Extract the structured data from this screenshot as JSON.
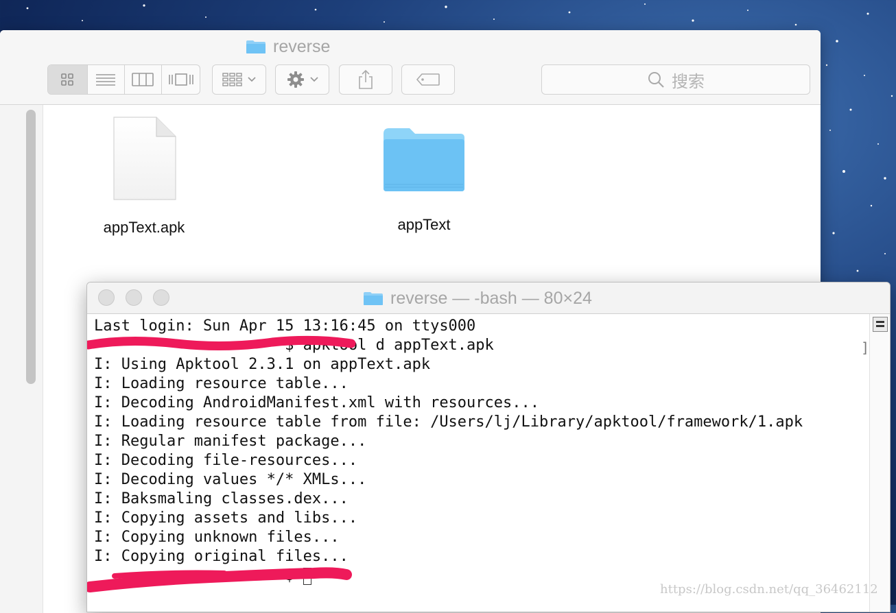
{
  "desktop": {
    "background": "#1d3f7a"
  },
  "finder": {
    "title": "reverse",
    "search_placeholder": "搜索",
    "files": [
      {
        "name": "appText.apk",
        "icon": "document-icon"
      },
      {
        "name": "appText",
        "icon": "folder-icon"
      }
    ]
  },
  "terminal": {
    "title": "reverse — -bash — 80×24",
    "lines": [
      "Last login: Sun Apr 15 13:16:45 on ttys000",
      "                     $ apktool d appText.apk",
      "I: Using Apktool 2.3.1 on appText.apk",
      "I: Loading resource table...",
      "I: Decoding AndroidManifest.xml with resources...",
      "I: Loading resource table from file: /Users/lj/Library/apktool/framework/1.apk",
      "I: Regular manifest package...",
      "I: Decoding file-resources...",
      "I: Decoding values */* XMLs...",
      "I: Baksmaling classes.dex...",
      "I: Copying assets and libs...",
      "I: Copying unknown files...",
      "I: Copying original files...",
      "                     $ "
    ],
    "right_bracket": "]"
  },
  "watermark": "https://blog.csdn.net/qq_36462112",
  "colors": {
    "redaction": "#ee1a5a",
    "folder_blue": "#6fc3f5"
  }
}
